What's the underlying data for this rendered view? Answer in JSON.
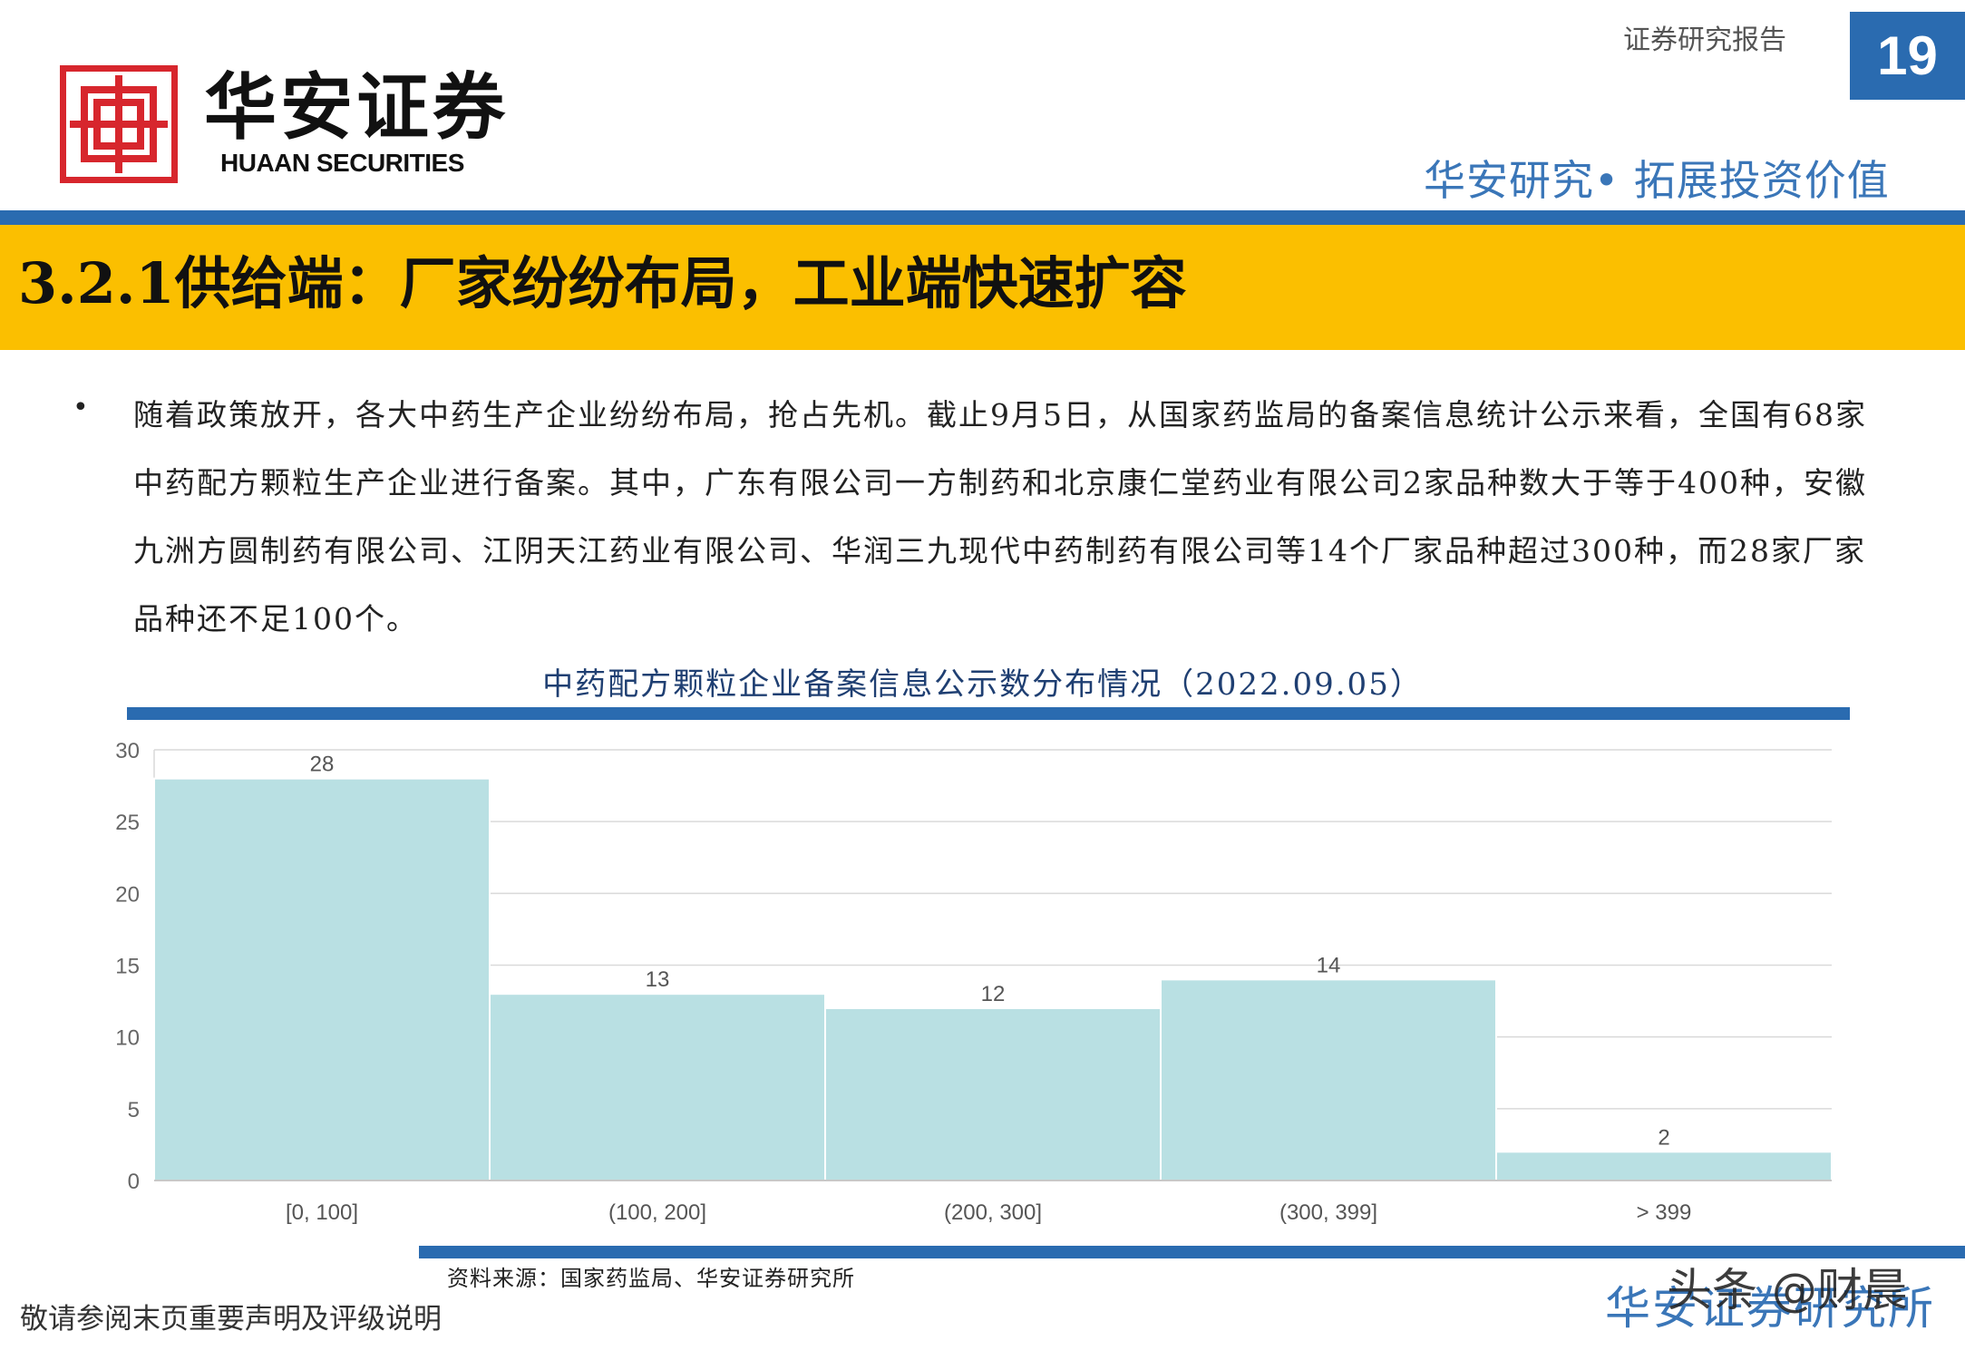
{
  "header": {
    "brand_cn": "华安证券",
    "brand_en": "HUAAN SECURITIES",
    "report_label": "证券研究报告",
    "page_number": "19",
    "slogan": "华安研究• 拓展投资价值",
    "colors": {
      "brand_red": "#d7262d",
      "brand_blue": "#2a6bb0",
      "title_band": "#fbbf00"
    }
  },
  "section": {
    "title": "3.2.1供给端：厂家纷纷布局，工业端快速扩容"
  },
  "body": {
    "bullet": "•",
    "paragraph": "随着政策放开，各大中药生产企业纷纷布局，抢占先机。截止9月5日，从国家药监局的备案信息统计公示来看，全国有68家中药配方颗粒生产企业进行备案。其中，广东有限公司一方制药和北京康仁堂药业有限公司2家品种数大于等于400种，安徽九洲方圆制药有限公司、江阴天江药业有限公司、华润三九现代中药制药有限公司等14个厂家品种超过300种，而28家厂家品种还不足100个。"
  },
  "chart_data": {
    "type": "bar",
    "title": "中药配方颗粒企业备案信息公示数分布情况（2022.09.05）",
    "categories": [
      "[0, 100]",
      "(100, 200]",
      "(200, 300]",
      "(300, 399]",
      "> 399"
    ],
    "values": [
      28,
      13,
      12,
      14,
      2
    ],
    "ylim": [
      0,
      30
    ],
    "yticks": [
      0,
      5,
      10,
      15,
      20,
      25,
      30
    ],
    "xlabel": "",
    "ylabel": "",
    "grid": true,
    "bar_color": "#b9e0e3",
    "data_labels": true
  },
  "source": "资料来源：国家药监局、华安证券研究所",
  "footer": {
    "disclaimer": "敬请参阅末页重要声明及评级说明",
    "brand": "华安证券研究所",
    "watermark": "头条 @财晨"
  }
}
